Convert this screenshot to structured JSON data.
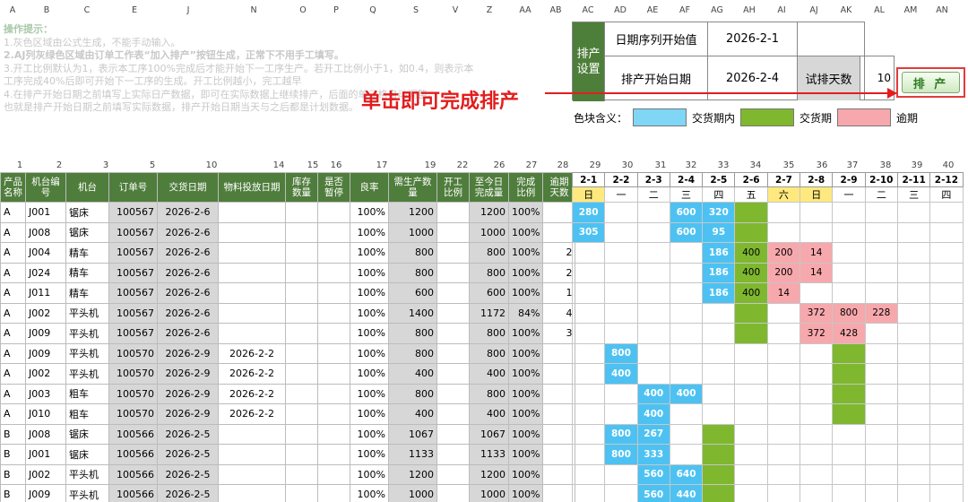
{
  "column_letters": [
    "A",
    "B",
    "C",
    "E",
    "J",
    "N",
    "O",
    "P",
    "Q",
    "S",
    "V",
    "Z",
    "AA",
    "AB",
    "AC",
    "AD",
    "AE",
    "AF",
    "AG",
    "AH",
    "AI",
    "AJ",
    "AK",
    "AL",
    "AM",
    "AN"
  ],
  "instructions": {
    "title": "操作提示：",
    "lines": [
      "1.灰色区域由公式生成，不能手动输入。",
      "2.AJ列灰绿色区域由订单工作表“加入排产”按钮生成，正常下不用手工填写。",
      "3.开工比例默认为1，表示本工序100%完成后才能开始下一工序生产。若开工比例小于1，如0.4，则表示本",
      "工序完成40%后即可开始下一工序的生成。开工比例越小，完工越早",
      "4.在排产开始日期之前填写上实际日产数据，即可在实际数据上继续排产，后面的单元格自动调整。",
      "也就是排产开始日期之前填写实际数据，排产开始日期当天与之后都是计划数据。"
    ]
  },
  "settings": {
    "section_label": "排产设置",
    "seq_start_label": "日期序列开始值",
    "seq_start_value": "2026-2-1",
    "sched_start_label": "排产开始日期",
    "sched_start_value": "2026-2-4",
    "trial_days_label": "试排天数",
    "trial_days_value": "10",
    "schedule_button": "排 产"
  },
  "callout": "单击即可完成排产",
  "legend": {
    "label": "色块含义：",
    "items": [
      {
        "text": "交货期内",
        "color": "#7fd6f5"
      },
      {
        "text": "交货期",
        "color": "#7fb82e"
      },
      {
        "text": "逾期",
        "color": "#f7a8ac"
      }
    ]
  },
  "column_numbers": [
    "1",
    "2",
    "3",
    "5",
    "10",
    "14",
    "15",
    "16",
    "17",
    "19",
    "22",
    "26",
    "27",
    "28",
    "29",
    "30",
    "31",
    "32",
    "33",
    "34",
    "35",
    "36",
    "37",
    "38",
    "39",
    "40"
  ],
  "table": {
    "headers": [
      "产品名称",
      "机台编号",
      "机台",
      "订单号",
      "交货日期",
      "物料投放日期",
      "库存数量",
      "是否暂停",
      "良率",
      "需生产数量",
      "开工比例",
      "至今日完成量",
      "完成比例",
      "逾期天数"
    ],
    "rows": [
      [
        "A",
        "J001",
        "锯床",
        "100567",
        "2026-2-6",
        "",
        "",
        "",
        "100%",
        "1200",
        "",
        "1200",
        "100%",
        ""
      ],
      [
        "A",
        "J008",
        "锯床",
        "100567",
        "2026-2-6",
        "",
        "",
        "",
        "100%",
        "1000",
        "",
        "1000",
        "100%",
        ""
      ],
      [
        "A",
        "J004",
        "精车",
        "100567",
        "2026-2-6",
        "",
        "",
        "",
        "100%",
        "800",
        "",
        "800",
        "100%",
        "2"
      ],
      [
        "A",
        "J024",
        "精车",
        "100567",
        "2026-2-6",
        "",
        "",
        "",
        "100%",
        "800",
        "",
        "800",
        "100%",
        "2"
      ],
      [
        "A",
        "J011",
        "精车",
        "100567",
        "2026-2-6",
        "",
        "",
        "",
        "100%",
        "600",
        "",
        "600",
        "100%",
        "1"
      ],
      [
        "A",
        "J002",
        "平头机",
        "100567",
        "2026-2-6",
        "",
        "",
        "",
        "100%",
        "1400",
        "",
        "1172",
        "84%",
        "4"
      ],
      [
        "A",
        "J009",
        "平头机",
        "100567",
        "2026-2-6",
        "",
        "",
        "",
        "100%",
        "800",
        "",
        "800",
        "100%",
        "3"
      ],
      [
        "A",
        "J009",
        "平头机",
        "100570",
        "2026-2-9",
        "2026-2-2",
        "",
        "",
        "100%",
        "800",
        "",
        "800",
        "100%",
        ""
      ],
      [
        "A",
        "J002",
        "平头机",
        "100570",
        "2026-2-9",
        "2026-2-2",
        "",
        "",
        "100%",
        "400",
        "",
        "400",
        "100%",
        ""
      ],
      [
        "A",
        "J003",
        "粗车",
        "100570",
        "2026-2-9",
        "2026-2-2",
        "",
        "",
        "100%",
        "800",
        "",
        "800",
        "100%",
        ""
      ],
      [
        "A",
        "J010",
        "粗车",
        "100570",
        "2026-2-9",
        "2026-2-2",
        "",
        "",
        "100%",
        "400",
        "",
        "400",
        "100%",
        ""
      ],
      [
        "B",
        "J008",
        "锯床",
        "100566",
        "2026-2-5",
        "",
        "",
        "",
        "100%",
        "1067",
        "",
        "1067",
        "100%",
        ""
      ],
      [
        "B",
        "J001",
        "锯床",
        "100566",
        "2026-2-5",
        "",
        "",
        "",
        "100%",
        "1133",
        "",
        "1133",
        "100%",
        ""
      ],
      [
        "B",
        "J002",
        "平头机",
        "100566",
        "2026-2-5",
        "",
        "",
        "",
        "100%",
        "1200",
        "",
        "1200",
        "100%",
        ""
      ],
      [
        "B",
        "J009",
        "平头机",
        "100566",
        "2026-2-5",
        "",
        "",
        "",
        "100%",
        "1000",
        "",
        "1000",
        "100%",
        ""
      ]
    ]
  },
  "schedule": {
    "dates": [
      "2-1",
      "2-2",
      "2-3",
      "2-4",
      "2-5",
      "2-6",
      "2-7",
      "2-8",
      "2-9",
      "2-10",
      "2-11",
      "2-12"
    ],
    "weekdays": [
      "日",
      "一",
      "二",
      "三",
      "四",
      "五",
      "六",
      "日",
      "一",
      "二",
      "三",
      "四"
    ],
    "rows": [
      [
        "280",
        "",
        "",
        "600",
        "320",
        "",
        "",
        "",
        "",
        "",
        "",
        ""
      ],
      [
        "305",
        "",
        "",
        "600",
        "95",
        "",
        "",
        "",
        "",
        "",
        "",
        ""
      ],
      [
        "",
        "",
        "",
        "",
        "186",
        "400",
        "200",
        "14",
        "",
        "",
        "",
        ""
      ],
      [
        "",
        "",
        "",
        "",
        "186",
        "400",
        "200",
        "14",
        "",
        "",
        "",
        ""
      ],
      [
        "",
        "",
        "",
        "",
        "186",
        "400",
        "14",
        "",
        "",
        "",
        "",
        ""
      ],
      [
        "",
        "",
        "",
        "",
        "",
        "",
        "",
        "372",
        "800",
        "228",
        "",
        ""
      ],
      [
        "",
        "",
        "",
        "",
        "",
        "",
        "",
        "372",
        "428",
        "",
        "",
        ""
      ],
      [
        "",
        "800",
        "",
        "",
        "",
        "",
        "",
        "",
        "",
        "",
        "",
        ""
      ],
      [
        "",
        "400",
        "",
        "",
        "",
        "",
        "",
        "",
        "",
        "",
        "",
        ""
      ],
      [
        "",
        "",
        "400",
        "400",
        "",
        "",
        "",
        "",
        "",
        "",
        "",
        ""
      ],
      [
        "",
        "",
        "400",
        "",
        "",
        "",
        "",
        "",
        "",
        "",
        "",
        ""
      ],
      [
        "",
        "800",
        "267",
        "",
        "",
        "",
        "",
        "",
        "",
        "",
        "",
        ""
      ],
      [
        "",
        "800",
        "333",
        "",
        "",
        "",
        "",
        "",
        "",
        "",
        "",
        ""
      ],
      [
        "",
        "",
        "560",
        "640",
        "",
        "",
        "",
        "",
        "",
        "",
        "",
        ""
      ],
      [
        "",
        "",
        "560",
        "440",
        "",
        "",
        "",
        "",
        "",
        "",
        "",
        ""
      ]
    ],
    "colors": [
      [
        "b",
        "",
        "",
        "b",
        "b",
        "g",
        "",
        "",
        "",
        "",
        "",
        ""
      ],
      [
        "b",
        "",
        "",
        "b",
        "b",
        "g",
        "",
        "",
        "",
        "",
        "",
        ""
      ],
      [
        "",
        "",
        "",
        "",
        "b",
        "g",
        "p",
        "p",
        "",
        "",
        "",
        ""
      ],
      [
        "",
        "",
        "",
        "",
        "b",
        "g",
        "p",
        "p",
        "",
        "",
        "",
        ""
      ],
      [
        "",
        "",
        "",
        "",
        "b",
        "g",
        "p",
        "",
        "",
        "",
        "",
        ""
      ],
      [
        "",
        "",
        "",
        "",
        "",
        "g",
        "",
        "p",
        "p",
        "p",
        "",
        ""
      ],
      [
        "",
        "",
        "",
        "",
        "",
        "g",
        "",
        "p",
        "p",
        "",
        "",
        ""
      ],
      [
        "",
        "b",
        "",
        "",
        "",
        "",
        "",
        "",
        "g",
        "",
        "",
        ""
      ],
      [
        "",
        "b",
        "",
        "",
        "",
        "",
        "",
        "",
        "g",
        "",
        "",
        ""
      ],
      [
        "",
        "",
        "b",
        "b",
        "",
        "",
        "",
        "",
        "g",
        "",
        "",
        ""
      ],
      [
        "",
        "",
        "b",
        "",
        "",
        "",
        "",
        "",
        "g",
        "",
        "",
        ""
      ],
      [
        "",
        "b",
        "b",
        "",
        "g",
        "",
        "",
        "",
        "",
        "",
        "",
        ""
      ],
      [
        "",
        "b",
        "b",
        "",
        "g",
        "",
        "",
        "",
        "",
        "",
        "",
        ""
      ],
      [
        "",
        "",
        "b",
        "b",
        "g",
        "",
        "",
        "",
        "",
        "",
        "",
        ""
      ],
      [
        "",
        "",
        "b",
        "b",
        "g",
        "",
        "",
        "",
        "",
        "",
        "",
        ""
      ]
    ]
  }
}
